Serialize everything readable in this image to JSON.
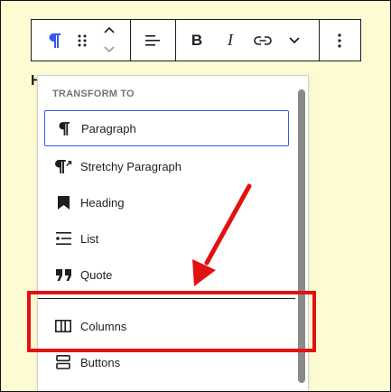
{
  "toolbar": {
    "paragraph_icon": "paragraph-icon",
    "drag_icon": "drag-handle-icon",
    "move_up_icon": "chevron-up-icon",
    "move_down_icon": "chevron-down-icon",
    "align_icon": "align-left-icon",
    "bold_label": "B",
    "italic_label": "I",
    "link_icon": "link-icon",
    "more_icon": "chevron-down-icon",
    "options_icon": "more-vertical-icon"
  },
  "behind_text": "H",
  "dropdown": {
    "heading": "TRANSFORM TO",
    "items": [
      {
        "label": "Paragraph",
        "icon": "paragraph-icon",
        "selected": true
      },
      {
        "label": "Stretchy Paragraph",
        "icon": "stretchy-paragraph-icon",
        "selected": false
      },
      {
        "label": "Heading",
        "icon": "bookmark-icon",
        "selected": false
      },
      {
        "label": "List",
        "icon": "list-icon",
        "selected": false
      },
      {
        "label": "Quote",
        "icon": "quote-icon",
        "selected": false
      },
      {
        "label": "Columns",
        "icon": "columns-icon",
        "selected": false
      },
      {
        "label": "Buttons",
        "icon": "buttons-icon",
        "selected": false
      }
    ]
  },
  "colors": {
    "page_background": "#fdfbd2",
    "selection_blue": "#3858e9",
    "highlight_red": "#e21212",
    "text": "#1e1e1e",
    "heading_gray": "#757575"
  }
}
